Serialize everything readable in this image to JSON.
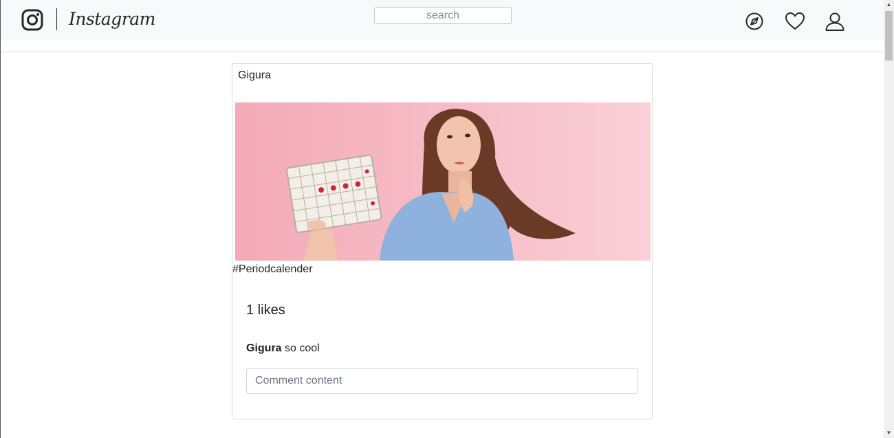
{
  "header": {
    "logo_text": "Instagram",
    "search_placeholder": "search",
    "icons": [
      "explore-icon",
      "heart-icon",
      "profile-icon"
    ]
  },
  "post": {
    "username": "Gigura",
    "image_icon": "photo-woman-with-calendar",
    "caption": "#Periodcalender",
    "likes": "1 likes",
    "comments": [
      {
        "user": "Gigura",
        "text": " so cool"
      }
    ],
    "comment_placeholder": "Comment content"
  },
  "colors": {
    "photo_background": "#f6b9c4",
    "header_background": "#f8f9fa",
    "border": "#dbdbdb"
  }
}
